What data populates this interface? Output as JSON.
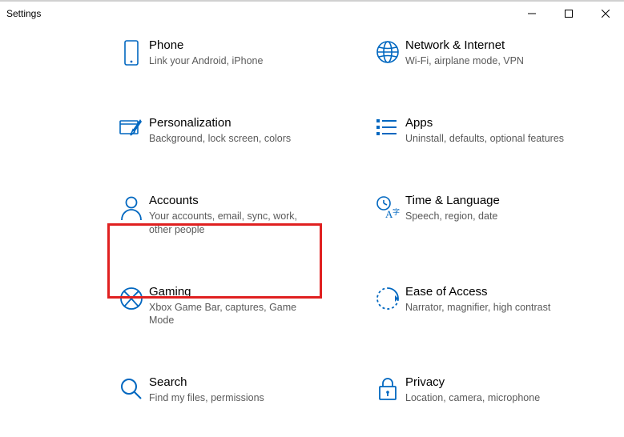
{
  "window": {
    "title": "Settings"
  },
  "tiles": {
    "phone": {
      "title": "Phone",
      "subtitle": "Link your Android, iPhone"
    },
    "network": {
      "title": "Network & Internet",
      "subtitle": "Wi-Fi, airplane mode, VPN"
    },
    "personalize": {
      "title": "Personalization",
      "subtitle": "Background, lock screen, colors"
    },
    "apps": {
      "title": "Apps",
      "subtitle": "Uninstall, defaults, optional features"
    },
    "accounts": {
      "title": "Accounts",
      "subtitle": "Your accounts, email, sync, work, other people"
    },
    "time": {
      "title": "Time & Language",
      "subtitle": "Speech, region, date"
    },
    "gaming": {
      "title": "Gaming",
      "subtitle": "Xbox Game Bar, captures, Game Mode"
    },
    "ease": {
      "title": "Ease of Access",
      "subtitle": "Narrator, magnifier, high contrast"
    },
    "search": {
      "title": "Search",
      "subtitle": "Find my files, permissions"
    },
    "privacy": {
      "title": "Privacy",
      "subtitle": "Location, camera, microphone"
    }
  }
}
